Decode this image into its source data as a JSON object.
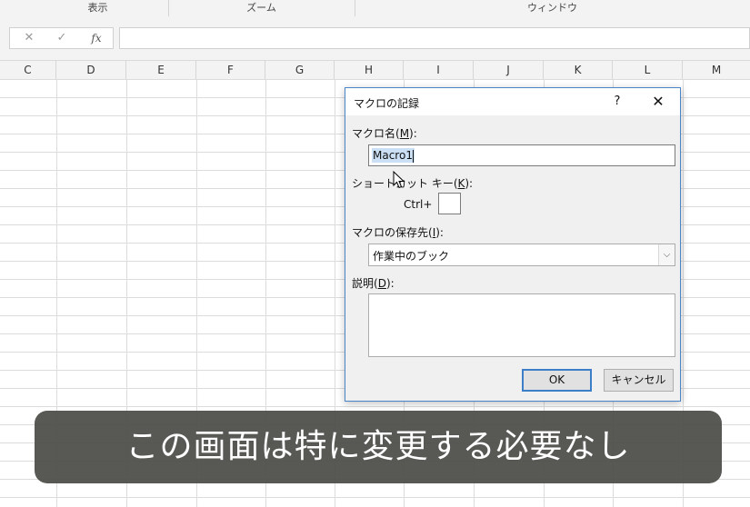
{
  "ribbon": {
    "groups": [
      {
        "label": "表示"
      },
      {
        "label": "ズーム"
      },
      {
        "label": "ウィンドウ"
      }
    ]
  },
  "formula_bar": {
    "cancel_glyph": "✕",
    "enter_glyph": "✓",
    "fx_label": "fx",
    "content": ""
  },
  "columns": [
    "C",
    "D",
    "E",
    "F",
    "G",
    "H",
    "I",
    "J",
    "K",
    "L",
    "M"
  ],
  "dialog": {
    "title": "マクロの記録",
    "help_glyph": "?",
    "close_glyph": "✕",
    "macro_name_label": "マクロ名(",
    "macro_name_key": "M",
    "macro_name_suffix": "):",
    "macro_name_value": "Macro1",
    "shortcut_label": "ショートカット キー(",
    "shortcut_key": "K",
    "shortcut_suffix": "):",
    "ctrl_label": "Ctrl+",
    "ctrl_value": "",
    "store_label": "マクロの保存先(",
    "store_key": "I",
    "store_suffix": "):",
    "store_value": "作業中のブック",
    "desc_label": "説明(",
    "desc_key": "D",
    "desc_suffix": "):",
    "desc_value": "",
    "ok_label": "OK",
    "cancel_label": "キャンセル"
  },
  "subtitle": "この画面は特に変更する必要なし",
  "colors": {
    "dialog_border": "#4a86c7",
    "ok_border": "#3d7ec8",
    "subtitle_bg": "#4a4a46",
    "selection": "#cce0f5"
  }
}
